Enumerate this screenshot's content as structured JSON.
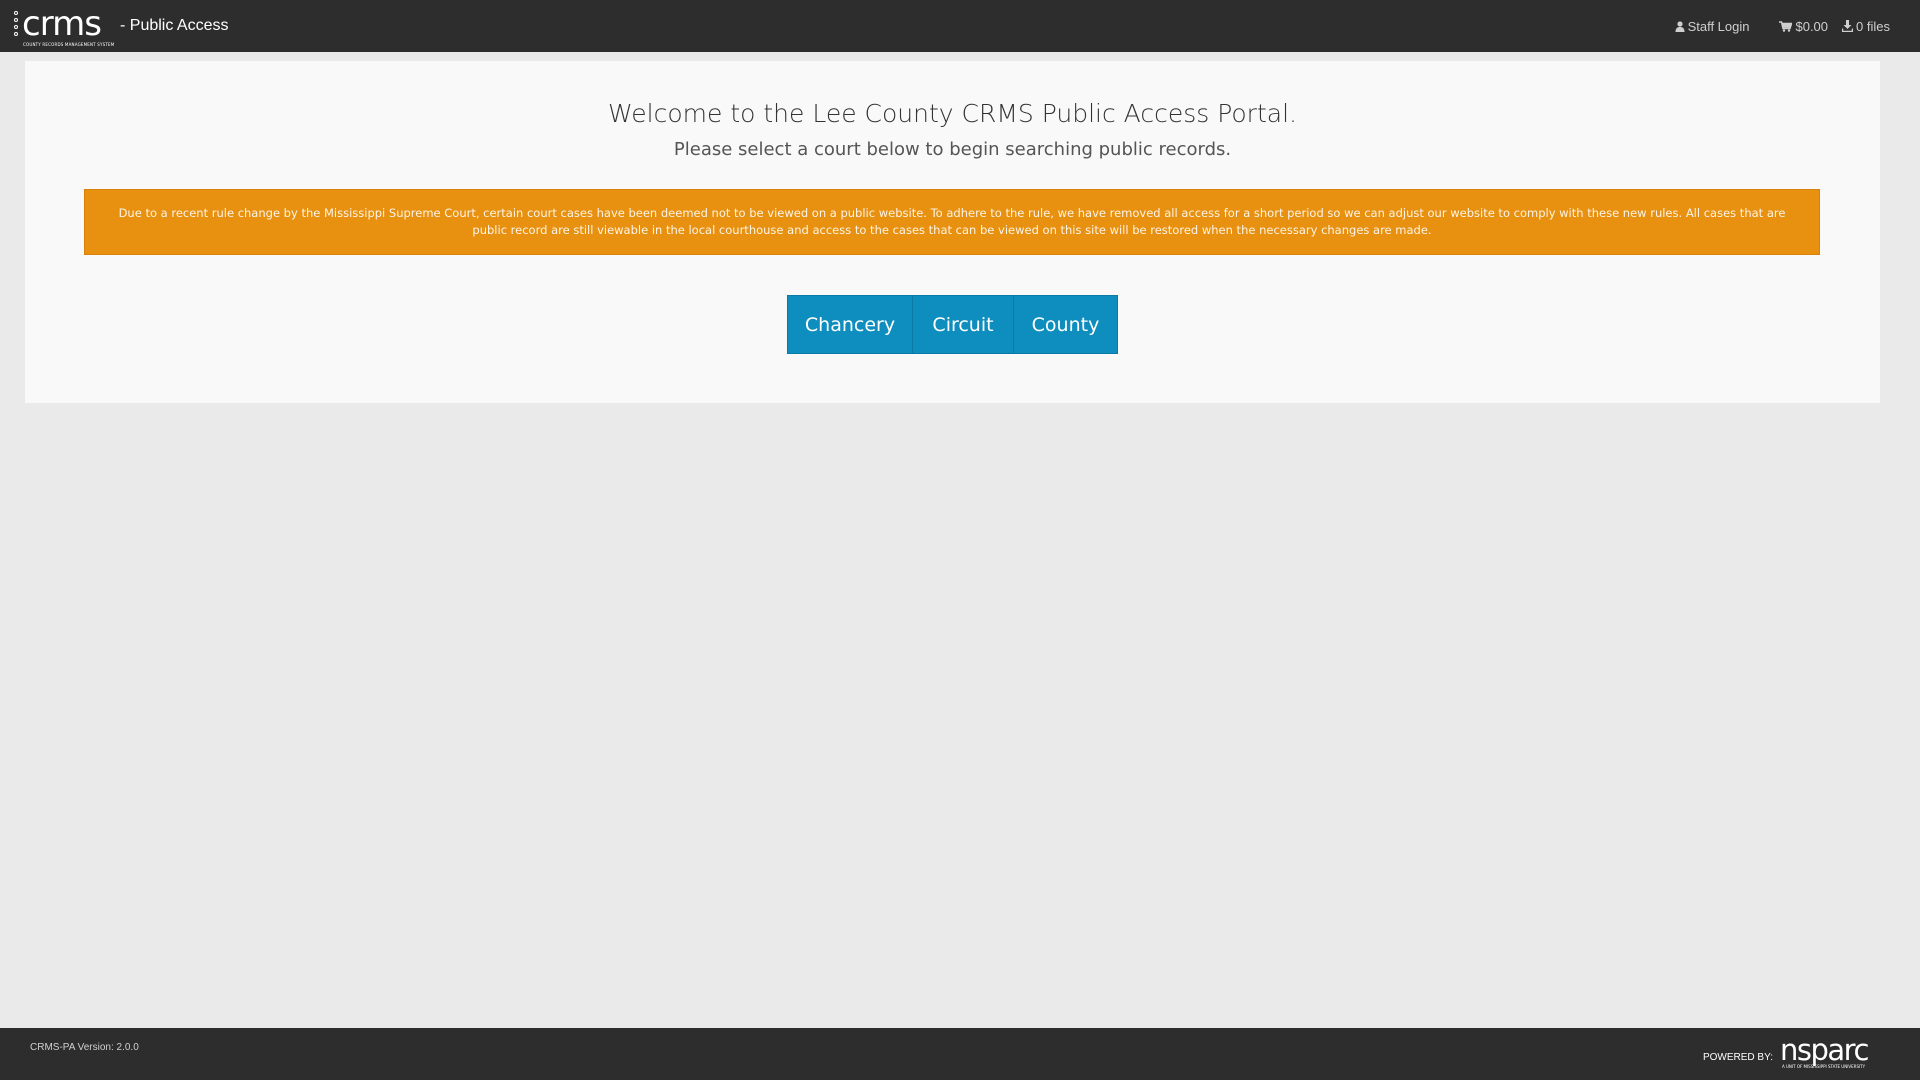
{
  "header": {
    "logo_text": "crms",
    "logo_tagline": "COUNTY RECORDS MANAGEMENT SYSTEM",
    "app_suffix": "- Public Access",
    "staff_login": "Staff Login",
    "cart_total": "$0.00",
    "download_count": "0 files"
  },
  "main": {
    "welcome": "Welcome to the Lee County CRMS Public Access Portal.",
    "subtitle": "Please select a court below to begin searching public records.",
    "alert_text": "Due to a recent rule change by the Mississippi Supreme Court, certain court cases have been deemed not to be viewed on a public website. To adhere to the rule, we have removed all access for a short period so we can adjust our website to comply with these new rules. All cases that are public record are still viewable in the local courthouse and access to the cases that can be viewed on this site will be restored when the necessary changes are made.",
    "courts": [
      "Chancery",
      "Circuit",
      "County"
    ]
  },
  "footer": {
    "version": "CRMS-PA Version: 2.0.0",
    "powered_by": "POWERED BY:",
    "vendor_logo_text": "nsparc",
    "vendor_tagline": "A UNIT OF MISSISSIPPI STATE UNIVERSITY"
  },
  "colors": {
    "navbar": "#2d2d2d",
    "background": "#eaeaea",
    "panel": "#f9f9f9",
    "alert": "#e8900f",
    "court_button": "#0e8ebf"
  },
  "icons": {
    "staff_login": "user-icon",
    "cart": "shopping-cart-icon",
    "downloads": "download-icon"
  }
}
